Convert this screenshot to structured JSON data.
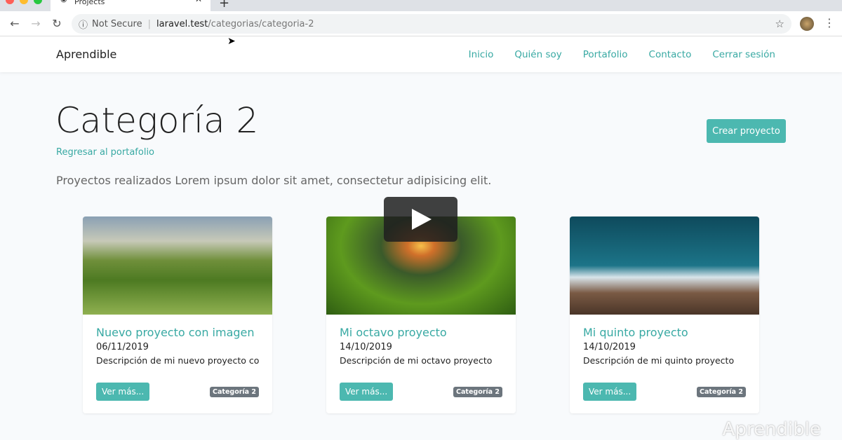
{
  "browser": {
    "tab_title": "Projects",
    "security": "Not Secure",
    "host": "laravel.test",
    "path": "/categorias/categoria-2"
  },
  "navbar": {
    "brand": "Aprendible",
    "links": [
      "Inicio",
      "Quién soy",
      "Portafolio",
      "Contacto",
      "Cerrar sesión"
    ]
  },
  "page": {
    "title": "Categoría 2",
    "back_link": "Regresar al portafolio",
    "create_button": "Crear proyecto",
    "lead": "Proyectos realizados Lorem ipsum dolor sit amet, consectetur adipisicing elit."
  },
  "projects": [
    {
      "title": "Nuevo proyecto con imagen",
      "date": "06/11/2019",
      "description": "Descripción de mi nuevo proyecto co...",
      "button": "Ver más...",
      "category": "Categoría 2"
    },
    {
      "title": "Mi octavo proyecto",
      "date": "14/10/2019",
      "description": "Descripción de mi octavo proyecto",
      "button": "Ver más...",
      "category": "Categoría 2"
    },
    {
      "title": "Mi quinto proyecto",
      "date": "14/10/2019",
      "description": "Descripción de mi quinto proyecto",
      "button": "Ver más...",
      "category": "Categoría 2"
    }
  ],
  "watermark": "Aprendible"
}
